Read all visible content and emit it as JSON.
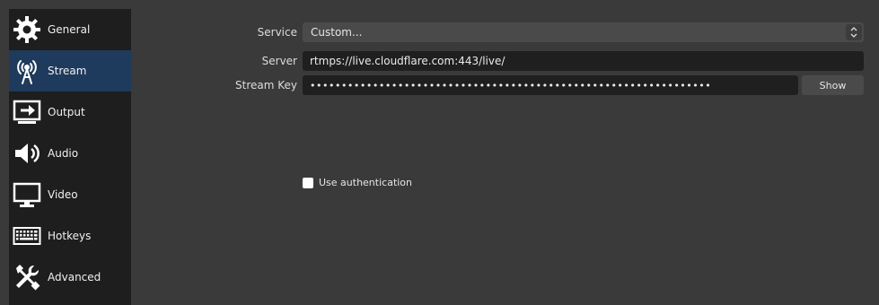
{
  "sidebar": {
    "items": [
      {
        "label": "General",
        "icon": "gear-icon"
      },
      {
        "label": "Stream",
        "icon": "antenna-icon"
      },
      {
        "label": "Output",
        "icon": "output-icon"
      },
      {
        "label": "Audio",
        "icon": "speaker-icon"
      },
      {
        "label": "Video",
        "icon": "monitor-icon"
      },
      {
        "label": "Hotkeys",
        "icon": "keyboard-icon"
      },
      {
        "label": "Advanced",
        "icon": "wrench-screwdriver-icon"
      }
    ],
    "active": "Stream"
  },
  "stream": {
    "service_label": "Service",
    "service_value": "Custom...",
    "server_label": "Server",
    "server_value": "rtmps://live.cloudflare.com:443/live/",
    "key_label": "Stream Key",
    "key_value": "••••••••••••••••••••••••••••••••••••••••••••••••••••••••••••••••",
    "show_label": "Show",
    "auth_label": "Use authentication",
    "auth_checked": false
  },
  "colors": {
    "background": "#3a3a3a",
    "sidebar": "#1e1e1e",
    "active_item": "#1e3a5c",
    "input_dark": "#1f1f1f",
    "button": "#4a4a4a"
  }
}
